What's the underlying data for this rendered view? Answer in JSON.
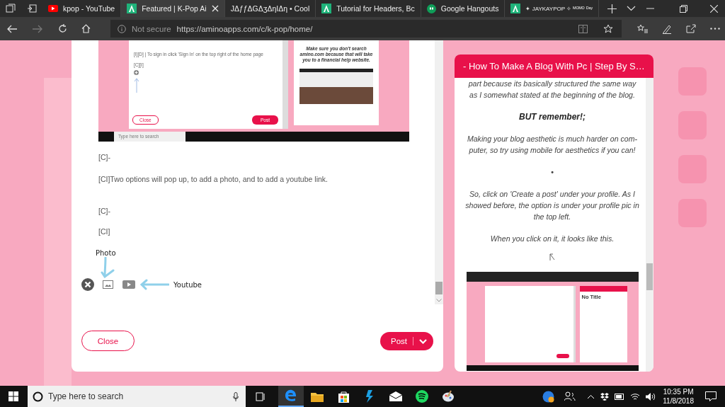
{
  "browser": {
    "tabs": [
      {
        "title": "kpop - YouTube",
        "kind": "youtube",
        "selected": false
      },
      {
        "title": "Featured | K-Pop Ai",
        "kind": "amino",
        "selected": true
      },
      {
        "title": "JΔƒƒΔGΔʒΔηIΔη • Cool",
        "kind": "none",
        "selected": false
      },
      {
        "title": "Tutorial for Headers, Bc",
        "kind": "amino",
        "selected": false
      },
      {
        "title": "Google Hangouts",
        "kind": "hangouts",
        "selected": false
      },
      {
        "title": "✦ JAYKAYPOP ✧ ᴹᴼᴹᴼ ᴰᵃʸ",
        "kind": "amino",
        "selected": false
      }
    ],
    "address": {
      "security": "Not secure",
      "url": "https://aminoapps.com/c/k-pop/home/"
    }
  },
  "editor": {
    "screenshot": {
      "instruction": "[I][D] | To sign in click 'Sign In' on the top right of the home page",
      "tag": "[C][I]",
      "close_button": "Close",
      "post_button": "Post",
      "notice": "Make sure you don't search amino.com because that will take you to a financial help website.",
      "search_placeholder": "Type here to search"
    },
    "lines": [
      "[C]-",
      "[CI]Two options will pop up, to add a photo, and to add a youtube link.",
      "[C]-",
      "[CI]"
    ],
    "photo_label": "Photo",
    "youtube_label": "Youtube",
    "close_button": "Close",
    "post_button": "Post"
  },
  "preview": {
    "title": "- How To Make A Blog With Pc | Step By S…",
    "paragraphs": [
      {
        "kind": "italic",
        "text": "part because its basically structured the same way as I somewhat stated at the beginning of the blog."
      },
      {
        "kind": "bold",
        "text": "BUT remember!;"
      },
      {
        "kind": "italic",
        "text": "Making your blog aesthetic is much harder on com-puter, so try using mobile for aesthetics if you can!"
      },
      {
        "kind": "bullet",
        "text": "•"
      },
      {
        "kind": "italic",
        "text": "So, click on 'Create a post' under your profile. As I showed before, the option is under your profile pic in the top left."
      },
      {
        "kind": "italic",
        "text": "When you click on it, it looks like this."
      }
    ],
    "screenshot": {
      "title": "No Title"
    }
  },
  "taskbar": {
    "search_placeholder": "Type here to search",
    "time": "10:35 PM",
    "date": "11/8/2018"
  }
}
